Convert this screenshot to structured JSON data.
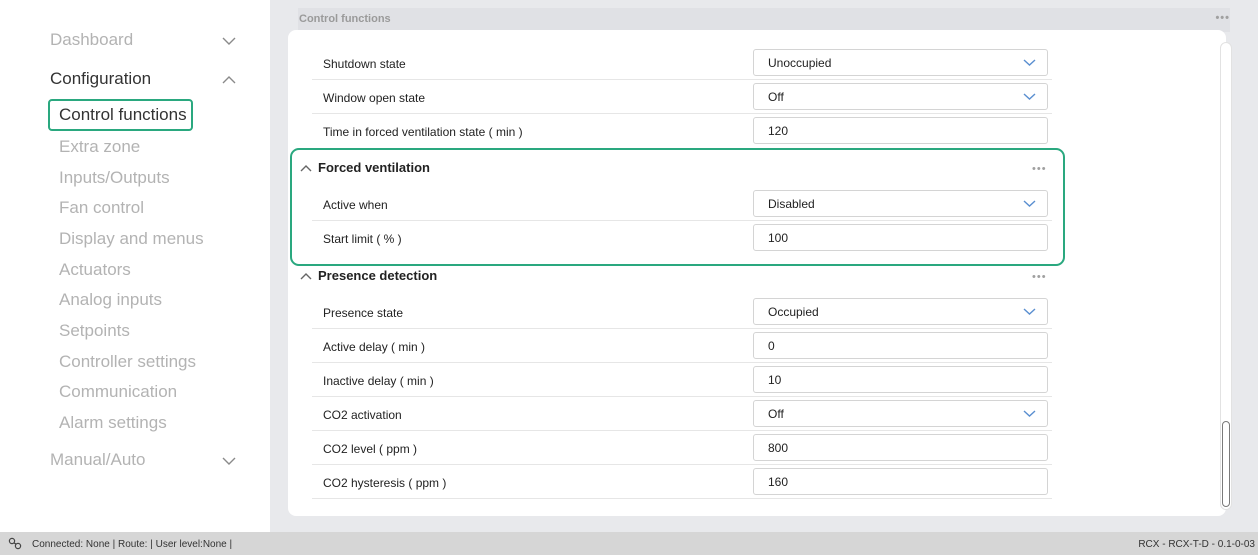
{
  "sidebar": {
    "dashboard": "Dashboard",
    "configuration": "Configuration",
    "items": [
      "Control functions",
      "Extra zone",
      "Inputs/Outputs",
      "Fan control",
      "Display and menus",
      "Actuators",
      "Analog inputs",
      "Setpoints",
      "Controller settings",
      "Communication",
      "Alarm settings"
    ],
    "manual_auto": "Manual/Auto"
  },
  "main": {
    "section_title": "Control functions",
    "section_more": "•••",
    "control_rows": [
      {
        "label": "Shutdown state",
        "value": "Unoccupied",
        "type": "select"
      },
      {
        "label": "Window open state",
        "value": "Off",
        "type": "select"
      },
      {
        "label": "Time in forced ventilation state ( min )",
        "value": "120",
        "type": "input"
      }
    ],
    "forced_ventilation": {
      "title": "Forced ventilation",
      "more": "•••",
      "rows": [
        {
          "label": "Active when",
          "value": "Disabled",
          "type": "select"
        },
        {
          "label": "Start limit ( % )",
          "value": "100",
          "type": "input"
        }
      ]
    },
    "presence_detection": {
      "title": "Presence detection",
      "more": "•••",
      "rows": [
        {
          "label": "Presence state",
          "value": "Occupied",
          "type": "select"
        },
        {
          "label": "Active delay ( min )",
          "value": "0",
          "type": "input"
        },
        {
          "label": "Inactive delay ( min )",
          "value": "10",
          "type": "input"
        },
        {
          "label": "CO2 activation",
          "value": "Off",
          "type": "select"
        },
        {
          "label": "CO2 level ( ppm )",
          "value": "800",
          "type": "input"
        },
        {
          "label": "CO2 hysteresis ( ppm )",
          "value": "160",
          "type": "input"
        }
      ]
    }
  },
  "status": {
    "left": "Connected: None | Route: | User level:None |",
    "right": "RCX - RCX-T-D - 0.1-0-03"
  },
  "colors": {
    "highlight": "#2aa87f",
    "active_text": "#333333",
    "inactive_text": "#b3b3b3",
    "panel_bg": "#e8e9ec"
  },
  "icons": [
    "chevron-down-icon",
    "chevron-up-icon",
    "more-icon",
    "connection-icon"
  ]
}
